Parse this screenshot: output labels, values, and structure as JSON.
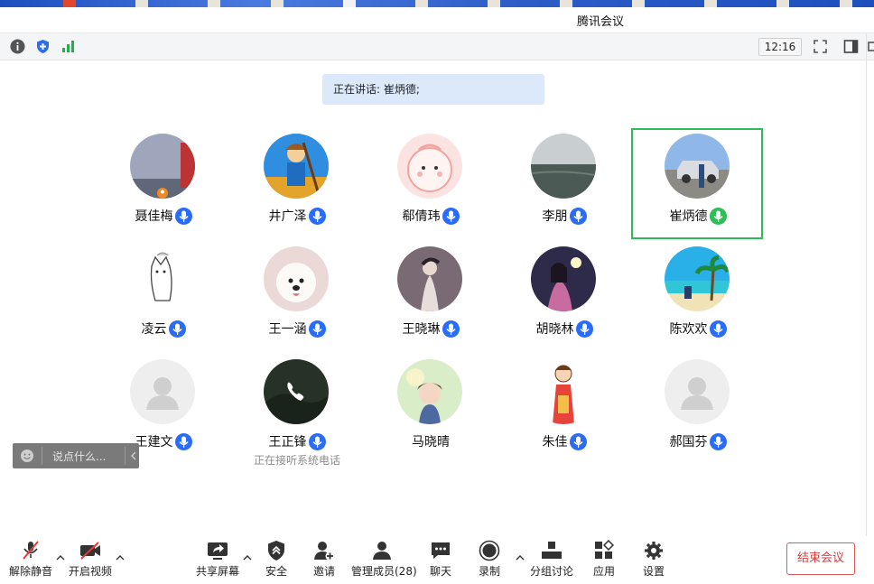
{
  "window": {
    "title": "腾讯会议"
  },
  "toolbar": {
    "time": "12:16",
    "icons": [
      "info-icon",
      "security-shield-icon",
      "signal-icon",
      "fullscreen-icon",
      "side-panel-icon"
    ]
  },
  "speaking": {
    "text": "正在讲话: 崔炳德;"
  },
  "participants": [
    {
      "name": "聂佳梅",
      "mic": "on",
      "host": true
    },
    {
      "name": "井广泽",
      "mic": "on"
    },
    {
      "name": "郗倩玮",
      "mic": "on"
    },
    {
      "name": "李朋",
      "mic": "on"
    },
    {
      "name": "崔炳德",
      "mic": "speaking",
      "active": true
    },
    {
      "name": "凌云",
      "mic": "on"
    },
    {
      "name": "王一涵",
      "mic": "on"
    },
    {
      "name": "王晓琳",
      "mic": "on"
    },
    {
      "name": "胡晓林",
      "mic": "on"
    },
    {
      "name": "陈欢欢",
      "mic": "on"
    },
    {
      "name": "王建文",
      "mic": "on"
    },
    {
      "name": "王正锋",
      "mic": "on",
      "status": "正在接听系统电话"
    },
    {
      "name": "马晓晴",
      "mic": "none"
    },
    {
      "name": "朱佳",
      "mic": "on"
    },
    {
      "name": "郝国芬",
      "mic": "on"
    }
  ],
  "chat": {
    "placeholder": "说点什么..."
  },
  "bottom": {
    "unmute": "解除静音",
    "video": "开启视频",
    "share": "共享屏幕",
    "security": "安全",
    "invite": "邀请",
    "members": "管理成员(28)",
    "chat": "聊天",
    "record": "录制",
    "breakout": "分组讨论",
    "apps": "应用",
    "settings": "设置",
    "end": "结束会议"
  },
  "colors": {
    "accent": "#2a6cf5",
    "speaking": "#2ebd57",
    "end": "#e03a3a",
    "banner": "#dbe9fb"
  }
}
